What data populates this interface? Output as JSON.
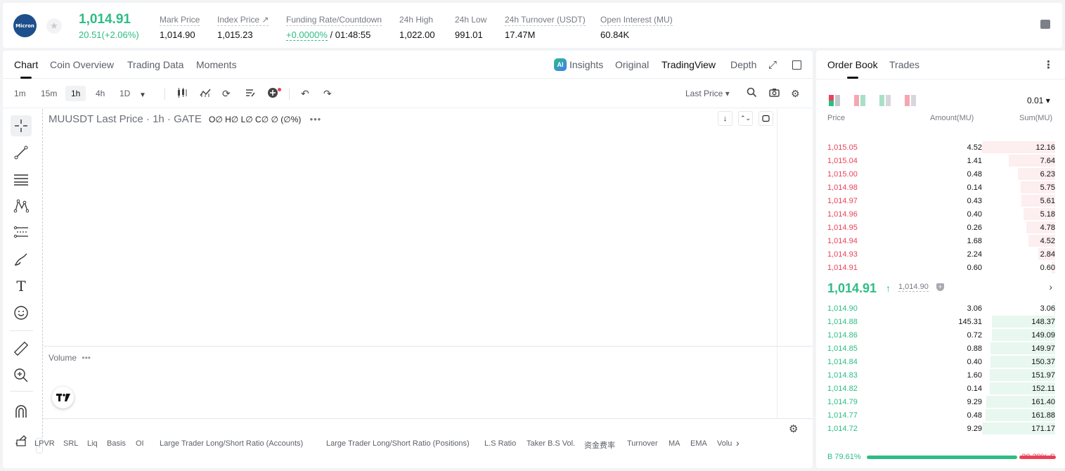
{
  "ticker": {
    "logo_text": "Micron",
    "last_price": "1,014.91",
    "change": "20.51(+2.06%)",
    "stats": [
      {
        "label": "Mark Price",
        "value": "1,014.90"
      },
      {
        "label": "Index Price ↗",
        "value": "1,015.23"
      },
      {
        "label": "Funding Rate/Countdown",
        "value_green": "+0.0000%",
        "value": " / 01:48:55"
      },
      {
        "label": "24h High",
        "value": "1,022.00"
      },
      {
        "label": "24h Low",
        "value": "991.01"
      },
      {
        "label": "24h Turnover (USDT)",
        "value": "17.47M"
      },
      {
        "label": "Open Interest (MU)",
        "value": "60.84K"
      }
    ]
  },
  "chart_tabs": [
    "Chart",
    "Coin Overview",
    "Trading Data",
    "Moments"
  ],
  "view_options": {
    "ai_badge": "AI",
    "insights": "Insights",
    "original": "Original",
    "tradingview": "TradingView",
    "depth": "Depth"
  },
  "intervals": [
    "1m",
    "15m",
    "1h",
    "4h",
    "1D"
  ],
  "price_source": "Last Price ▾",
  "legend": {
    "title": "MUUSDT Last Price · 1h · GATE",
    "ohlc": "O∅ H∅ L∅ C∅ ∅ (∅%)",
    "dots": "•••"
  },
  "volume_label": "Volume",
  "volume_dots": "•••",
  "indicators": [
    "LPVR",
    "SRL",
    "Liq",
    "Basis",
    "OI",
    "Large Trader Long/Short Ratio (Accounts)",
    "Large Trader Long/Short Ratio (Positions)",
    "L.S Ratio",
    "Taker B.S Vol.",
    "资金费率",
    "Turnover",
    "MA",
    "EMA",
    "Volu"
  ],
  "book": {
    "tabs": [
      "Order Book",
      "Trades"
    ],
    "precision": "0.01 ▾",
    "headers": {
      "price": "Price",
      "amount": "Amount(MU)",
      "sum": "Sum(MU)"
    },
    "asks": [
      {
        "price": "1,015.05",
        "amount": "4.52",
        "sum": "12.16",
        "fill": 1.0
      },
      {
        "price": "1,015.04",
        "amount": "1.41",
        "sum": "7.64",
        "fill": 0.63
      },
      {
        "price": "1,015.00",
        "amount": "0.48",
        "sum": "6.23",
        "fill": 0.51
      },
      {
        "price": "1,014.98",
        "amount": "0.14",
        "sum": "5.75",
        "fill": 0.47
      },
      {
        "price": "1,014.97",
        "amount": "0.43",
        "sum": "5.61",
        "fill": 0.46
      },
      {
        "price": "1,014.96",
        "amount": "0.40",
        "sum": "5.18",
        "fill": 0.43
      },
      {
        "price": "1,014.95",
        "amount": "0.26",
        "sum": "4.78",
        "fill": 0.39
      },
      {
        "price": "1,014.94",
        "amount": "1.68",
        "sum": "4.52",
        "fill": 0.37
      },
      {
        "price": "1,014.93",
        "amount": "2.24",
        "sum": "2.84",
        "fill": 0.23
      },
      {
        "price": "1,014.91",
        "amount": "0.60",
        "sum": "0.60",
        "fill": 0.05
      }
    ],
    "mid_price": "1,014.91",
    "mid_arrow": "↑",
    "mark_price": "1,014.90",
    "bids": [
      {
        "price": "1,014.90",
        "amount": "3.06",
        "sum": "3.06",
        "fill": 0.02
      },
      {
        "price": "1,014.88",
        "amount": "145.31",
        "sum": "148.37",
        "fill": 0.87
      },
      {
        "price": "1,014.86",
        "amount": "0.72",
        "sum": "149.09",
        "fill": 0.87
      },
      {
        "price": "1,014.85",
        "amount": "0.88",
        "sum": "149.97",
        "fill": 0.88
      },
      {
        "price": "1,014.84",
        "amount": "0.40",
        "sum": "150.37",
        "fill": 0.88
      },
      {
        "price": "1,014.83",
        "amount": "1.60",
        "sum": "151.97",
        "fill": 0.89
      },
      {
        "price": "1,014.82",
        "amount": "0.14",
        "sum": "152.11",
        "fill": 0.89
      },
      {
        "price": "1,014.79",
        "amount": "9.29",
        "sum": "161.40",
        "fill": 0.94
      },
      {
        "price": "1,014.77",
        "amount": "0.48",
        "sum": "161.88",
        "fill": 0.95
      },
      {
        "price": "1,014.72",
        "amount": "9.29",
        "sum": "171.17",
        "fill": 1.0
      }
    ],
    "buy_ratio": "B 79.61%",
    "sell_ratio": "20.39% S",
    "buy_fraction": 0.7961
  },
  "colors": {
    "up": "#2dbd85",
    "down": "#e94359"
  }
}
